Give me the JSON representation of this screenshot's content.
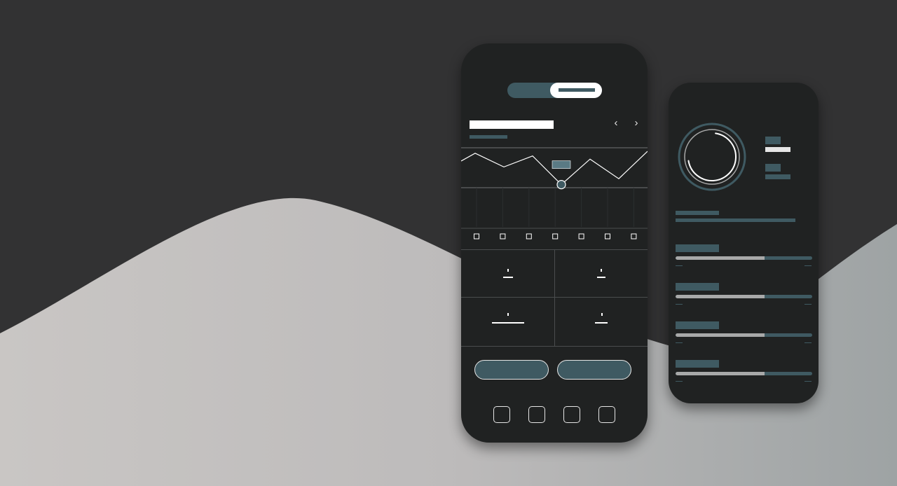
{
  "colors": {
    "background_dark": "#323233",
    "background_hill": "#c2c0bf",
    "phone_body": "#202222",
    "accent": "#3f5a62",
    "foreground": "#ffffff",
    "muted": "#a8a9a9"
  },
  "main_phone": {
    "toggle": {
      "active_option": "right"
    },
    "chart_nav": {
      "prev_icon": "chevron-left-icon",
      "next_icon": "chevron-right-icon"
    },
    "chart": {
      "points": [
        0.25,
        0.05,
        0.4,
        0.12,
        0.85,
        0.2,
        0.7,
        0.0
      ],
      "highlighted_index": 4,
      "tick_count": 7
    },
    "actions": [
      "primary-action",
      "secondary-action"
    ],
    "navbar_icons": [
      "home-icon",
      "stats-icon",
      "calendar-icon",
      "profile-icon"
    ]
  },
  "side_phone": {
    "ring": {
      "progress": 0.7
    },
    "progress_items": [
      {
        "progress": 0.65
      },
      {
        "progress": 0.65
      },
      {
        "progress": 0.65
      },
      {
        "progress": 0.65
      }
    ]
  }
}
